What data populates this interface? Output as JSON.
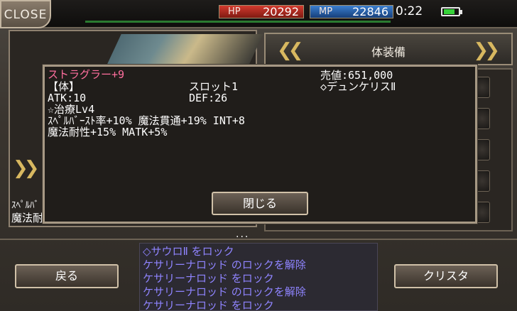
{
  "top_bar": {
    "close_label": "CLOSE",
    "hp_label": "HP",
    "hp_value": "20292",
    "mp_label": "MP",
    "mp_value": "22846",
    "clock": "0:22",
    "battery_level": 0.8
  },
  "equipment_header": {
    "title": "体装備",
    "prev_arrow": "❮❮",
    "next_arrow": "❯❯"
  },
  "left_panel": {
    "chevron": "❯❯",
    "text1": "ｽﾍﾟﾙﾊﾞ",
    "text2": "魔法耐"
  },
  "item_popup": {
    "name": "ストラグラー+9",
    "sell_value": "売値:651,000",
    "category": "【体】",
    "slot": "スロット1",
    "crysta": "◇デュンケリスⅡ",
    "atk": "ATK:10",
    "def": "DEF:26",
    "skill": "☆治療Lv4",
    "stats_line1": "ｽﾍﾟﾙﾊﾞｰｽﾄ率+10% 魔法貫通+19% INT+8",
    "stats_line2": "魔法耐性+15% MATK+5%",
    "close_button": "閉じる",
    "more_indicator": "..."
  },
  "bottom": {
    "back_button": "戻る",
    "crysta_button": "クリスタ",
    "log_lines": [
      "◇サウロⅡ をロック",
      "ケサリーナロッド のロックを解除",
      "ケサリーナロッド をロック",
      "ケサリーナロッド のロックを解除",
      "ケサリーナロッド をロック"
    ]
  },
  "colors": {
    "item_name": "#ff6f9e",
    "log_text": "#8f84ff",
    "hp": "#d33b2e",
    "mp": "#3b7fd0"
  }
}
